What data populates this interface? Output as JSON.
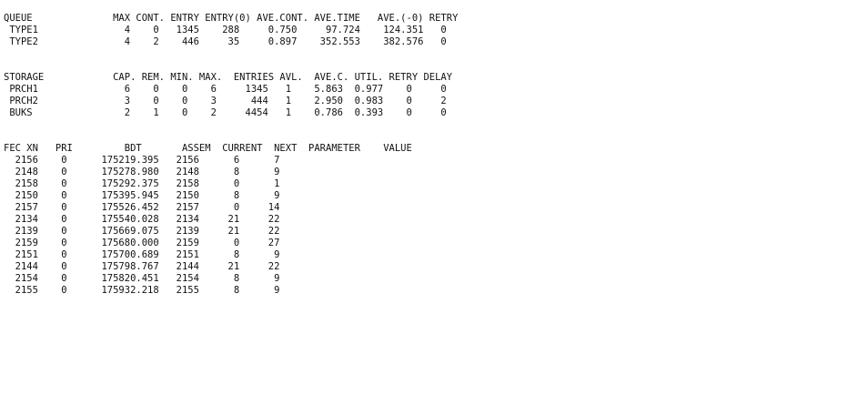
{
  "queue": {
    "header": "QUEUE              MAX CONT. ENTRY ENTRY(0) AVE.CONT. AVE.TIME   AVE.(-0) RETRY",
    "rows": [
      " TYPE1               4    0   1345    288     0.750     97.724    124.351   0",
      " TYPE2               4    2    446     35     0.897    352.553    382.576   0"
    ]
  },
  "storage": {
    "header": "STORAGE            CAP. REM. MIN. MAX.  ENTRIES AVL.  AVE.C. UTIL. RETRY DELAY",
    "rows": [
      " PRCH1               6    0    0    6     1345   1    5.863  0.977    0     0",
      " PRCH2               3    0    0    3      444   1    2.950  0.983    0     2",
      " BUKS                2    1    0    2     4454   1    0.786  0.393    0     0"
    ]
  },
  "fec": {
    "header": "FEC XN   PRI         BDT       ASSEM  CURRENT  NEXT  PARAMETER    VALUE",
    "rows": [
      "  2156    0      175219.395   2156      6      7",
      "  2148    0      175278.980   2148      8      9",
      "  2158    0      175292.375   2158      0      1",
      "  2150    0      175395.945   2150      8      9",
      "  2157    0      175526.452   2157      0     14",
      "  2134    0      175540.028   2134     21     22",
      "  2139    0      175669.075   2139     21     22",
      "  2159    0      175680.000   2159      0     27",
      "  2151    0      175700.689   2151      8      9",
      "  2144    0      175798.767   2144     21     22",
      "  2154    0      175820.451   2154      8      9",
      "  2155    0      175932.218   2155      8      9"
    ]
  }
}
